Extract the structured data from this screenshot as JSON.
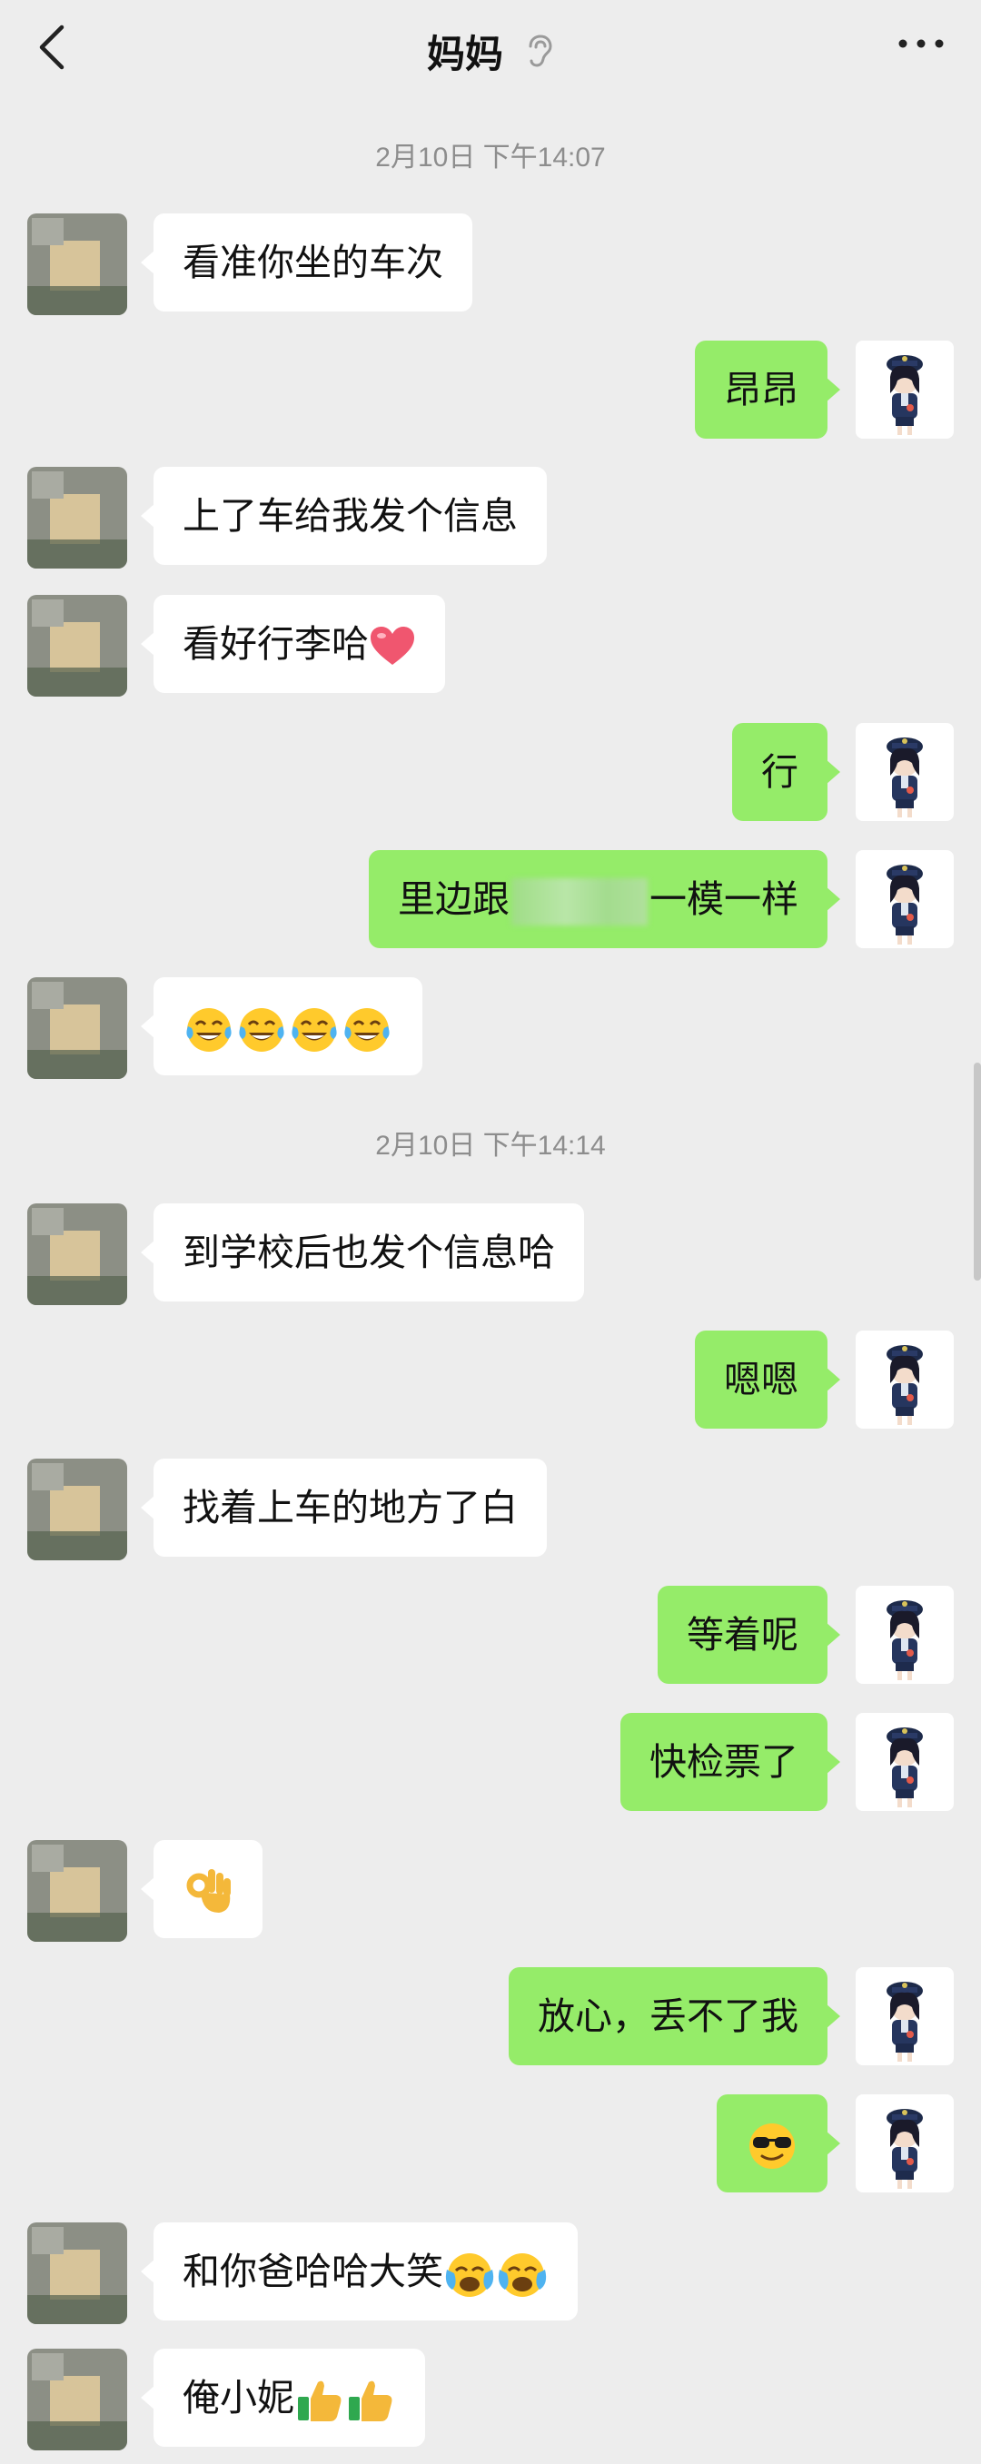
{
  "header": {
    "title": "妈妈",
    "back_icon": "chevron-left-icon",
    "ear_icon": "ear-icon",
    "more_icon": "more-icon"
  },
  "timestamps": [
    "2月10日 下午14:07",
    "2月10日 下午14:14"
  ],
  "messages": [
    {
      "side": "in",
      "text": "看准你坐的车次"
    },
    {
      "side": "out",
      "text": "昂昂"
    },
    {
      "side": "in",
      "text": "上了车给我发个信息"
    },
    {
      "side": "in",
      "text": "看好行李哈",
      "emoji": "heart"
    },
    {
      "side": "out",
      "text": "行"
    },
    {
      "side": "out",
      "text_before": "里边跟",
      "text_after": "一模一样",
      "redacted": true
    },
    {
      "side": "in",
      "emoji": "tears-of-joy",
      "emoji_count": 4
    },
    {
      "side": "in",
      "text": "到学校后也发个信息哈"
    },
    {
      "side": "out",
      "text": "嗯嗯"
    },
    {
      "side": "in",
      "text": "找着上车的地方了白"
    },
    {
      "side": "out",
      "text": "等着呢"
    },
    {
      "side": "out",
      "text": "快检票了"
    },
    {
      "side": "in",
      "emoji": "ok-hand"
    },
    {
      "side": "out",
      "text": "放心，丢不了我"
    },
    {
      "side": "out",
      "emoji": "sunglasses-face"
    },
    {
      "side": "in",
      "text": "和你爸哈哈大笑",
      "emoji": "loudly-crying-laughing",
      "emoji_count": 2
    },
    {
      "side": "in",
      "text": "俺小妮",
      "emoji": "thumbs-up",
      "emoji_count": 2
    }
  ],
  "colors": {
    "background": "#ededed",
    "incoming_bubble": "#ffffff",
    "outgoing_bubble": "#95ec69",
    "timestamp_text": "#8d8d8d"
  }
}
